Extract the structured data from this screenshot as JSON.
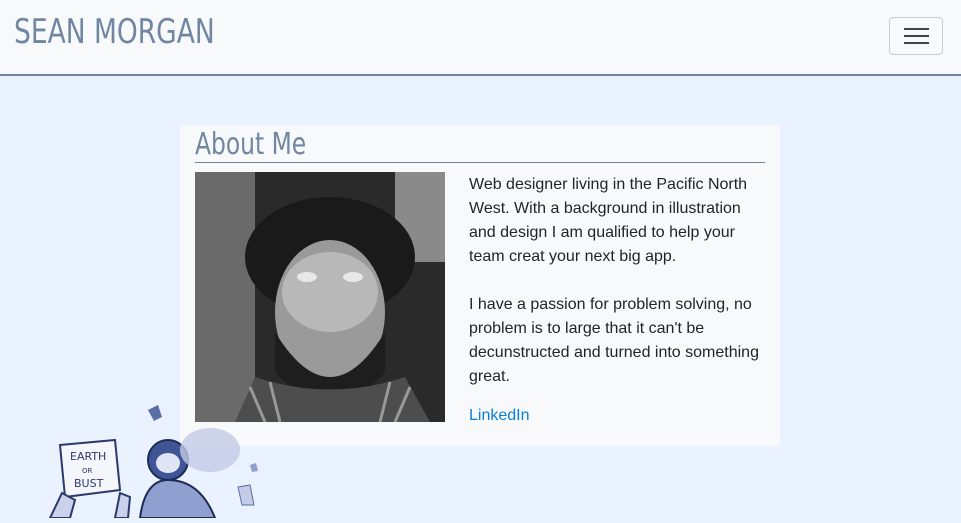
{
  "header": {
    "brand": "SEAN MORGAN",
    "menu_icon": "hamburger-menu-icon"
  },
  "about": {
    "title": "About Me",
    "photo_icon": "profile-photo",
    "paragraphs": [
      "Web designer living in the Pacific North West. With a background in illustration and design I am qualified to help your team creat your next big app.",
      "I have a passion for problem solving, no problem is to large that it can't be decunstructed and turned into something great."
    ],
    "link_label": "LinkedIn"
  },
  "illustration": {
    "sign_text": "EARTH OR BUST"
  },
  "colors": {
    "accent": "#7086a3",
    "link": "#0a7fd8",
    "page_bg": "#eaf1ff",
    "card_bg": "#f7f9fb"
  }
}
